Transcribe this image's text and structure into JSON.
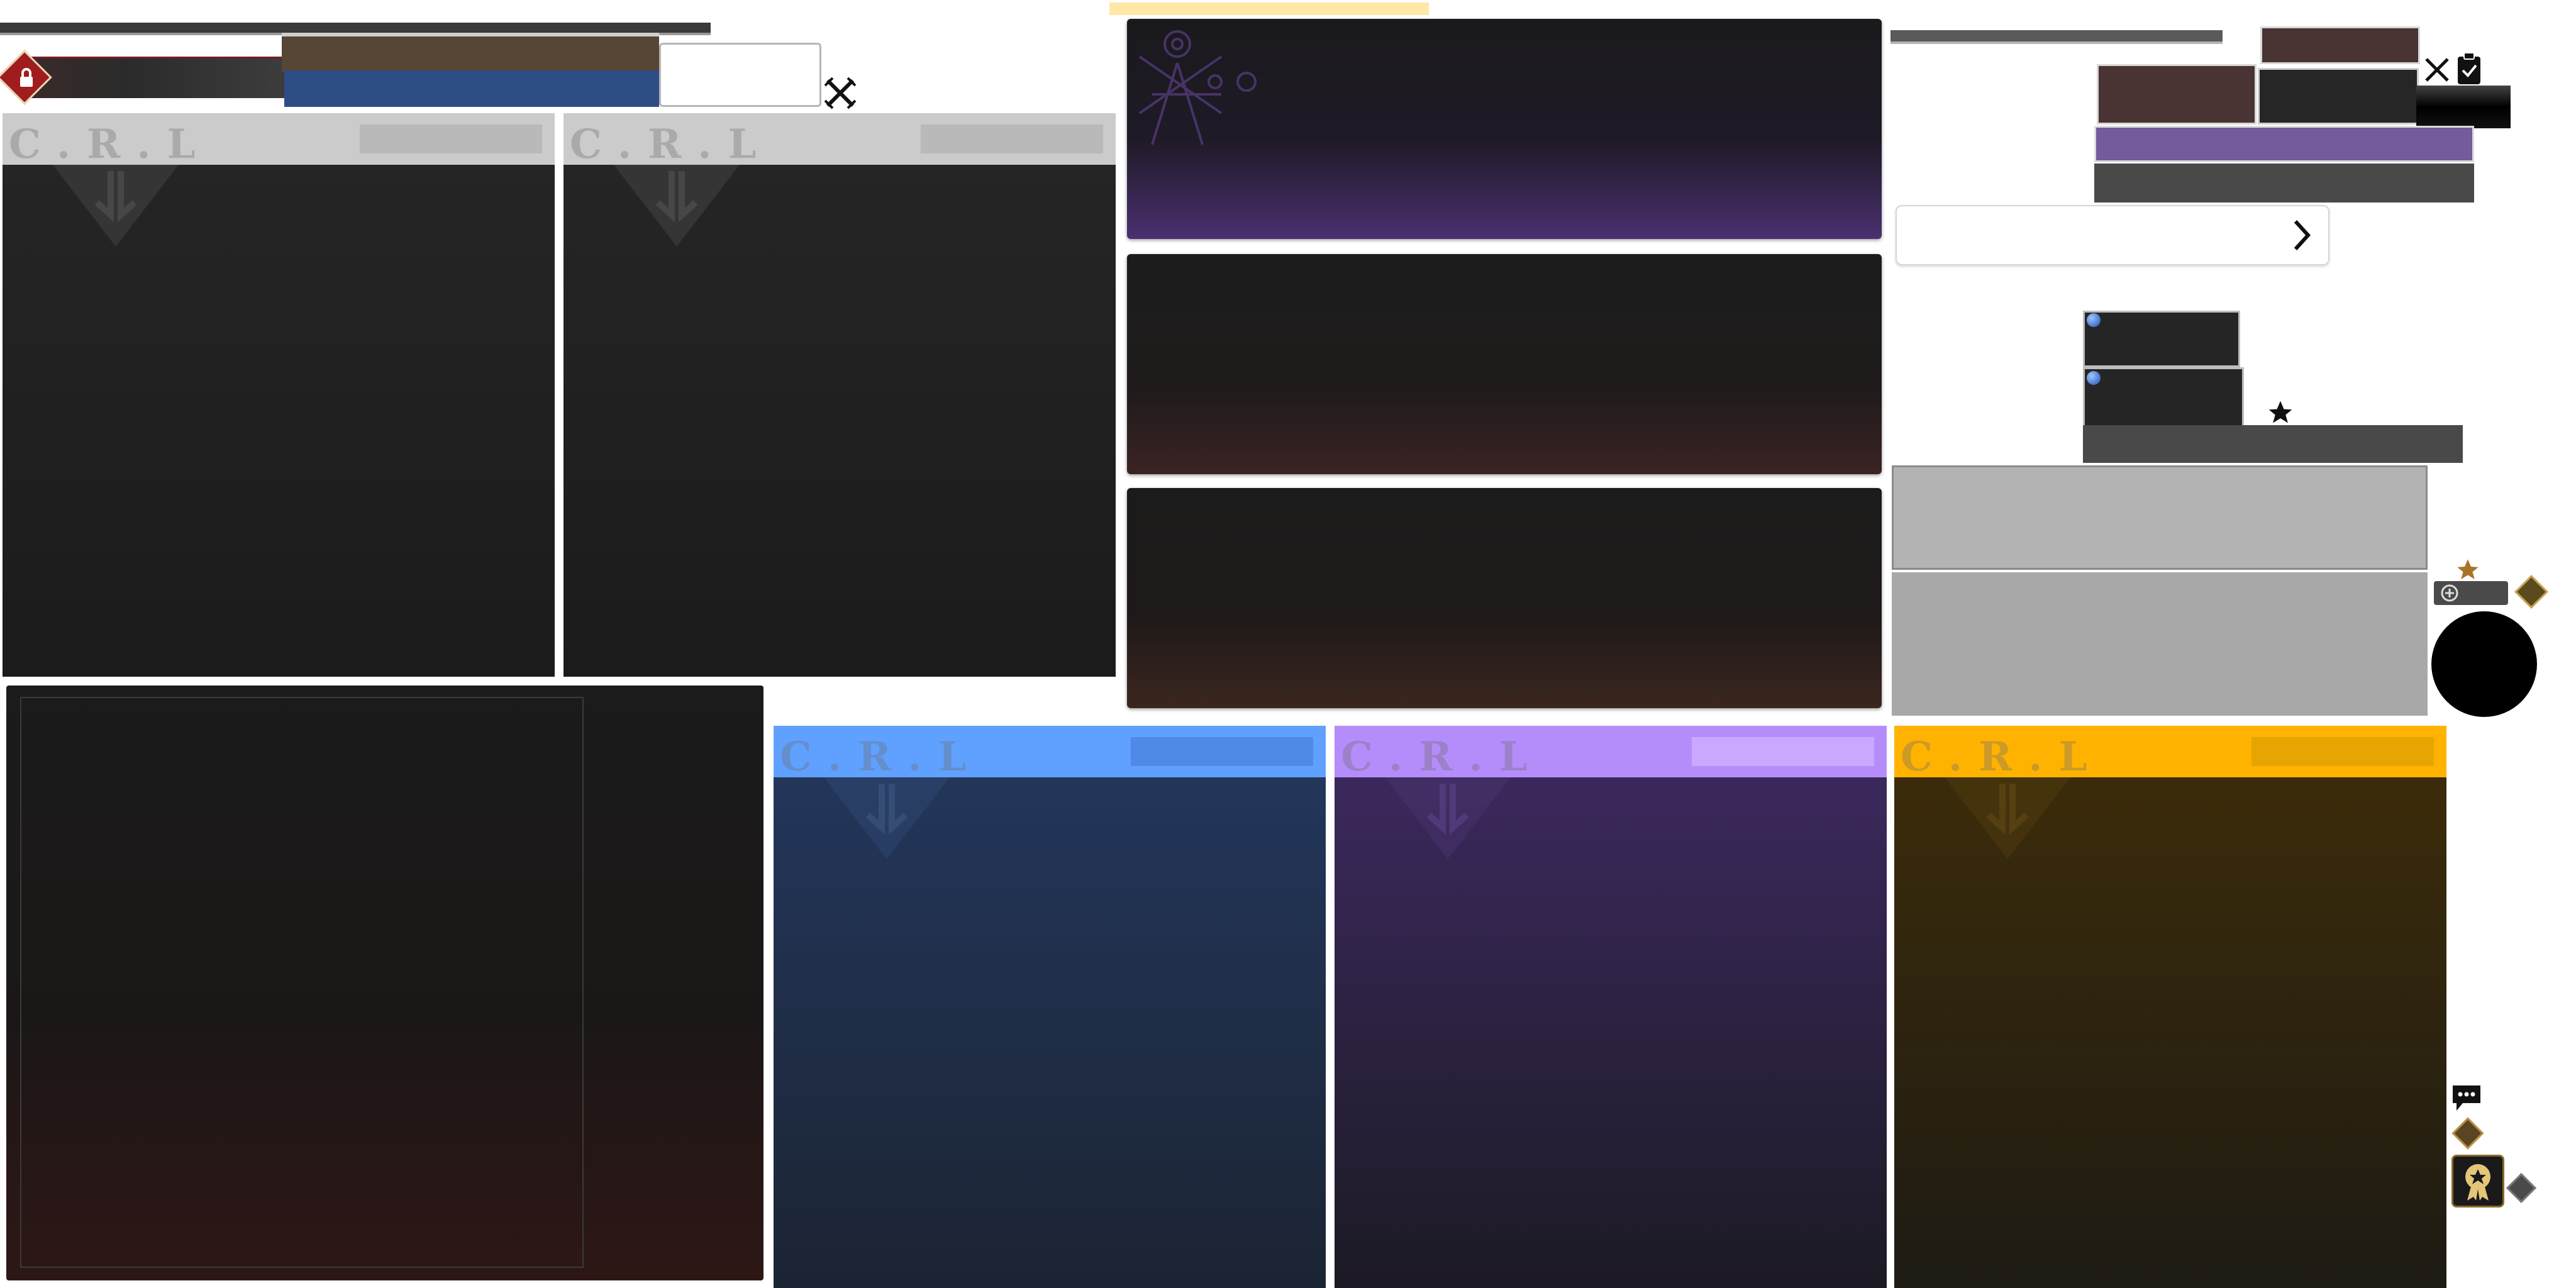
{
  "cards": {
    "logo_text": "C.R.L",
    "tag_colors": {
      "gray": "#cbcbcb",
      "blue": "#60a1ff",
      "purple": "#b58dfb",
      "gold": "#ffb300"
    }
  },
  "panels": {
    "accent_purple": "#4a3070",
    "accent_red": "#3a2323"
  },
  "icons": [
    "lock-icon",
    "crossed-swords-icon",
    "clipboard-check-icon",
    "chevron-right-icon",
    "star-icon",
    "plus-circle-icon",
    "gift-icon",
    "chat-bubble-icon",
    "medal-icon",
    "diamond-icon",
    "emblem-icon",
    "blue-orb-icon"
  ]
}
